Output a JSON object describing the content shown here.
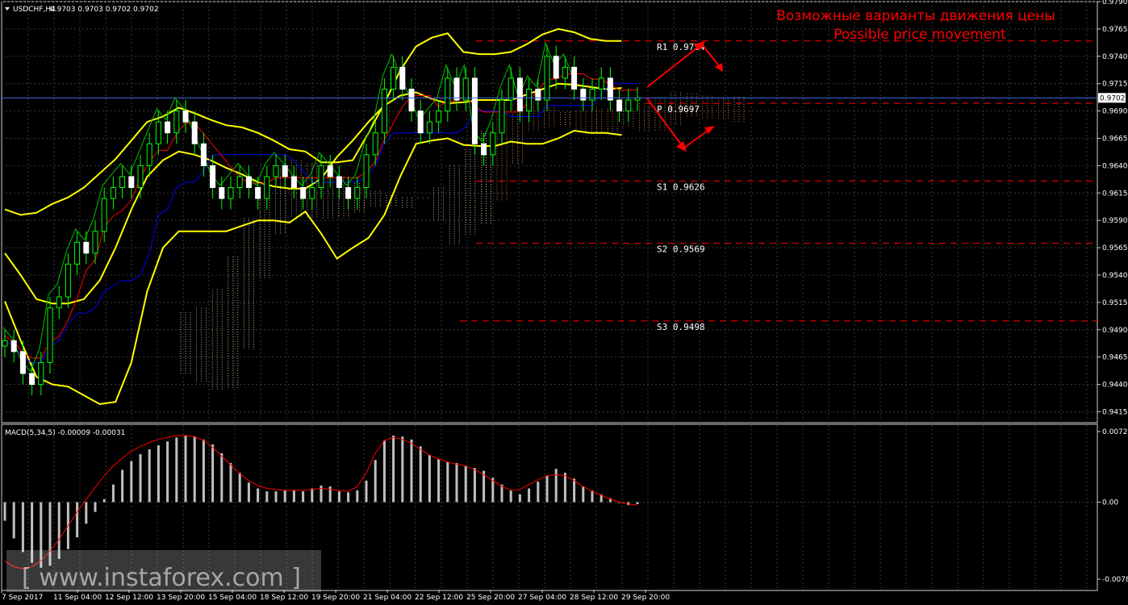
{
  "main_header": {
    "symbol": "USDCHF,H4",
    "ohlc": "0.9703 0.9703 0.9702 0.9702"
  },
  "annotation": {
    "ru": "Возможные варианты движения цены",
    "en": "Possible price movement"
  },
  "current_price_label": "0.9702",
  "watermark": "[ www.instaforex.com ]",
  "colors": {
    "background": "#000000",
    "grid": "#3a3a3a",
    "axis_text": "#ffffff",
    "candle_bull": "#00ff00",
    "bollinger": "#ffff00",
    "tenkan": "#ff0000",
    "kijun": "#0000ff",
    "chikou": "#00c000",
    "kumo_a": "#f4a460",
    "kumo_b": "#f5deb3",
    "pivot_level": "#ff0000",
    "annotation": "#ff0000",
    "macd_hist": "#c0c0c0",
    "macd_signal": "#ff0000",
    "current_price_line": "#4169e1"
  },
  "chart_data": [
    {
      "type": "candlestick",
      "title": "USDCHF,H4",
      "ylim": [
        0.9405,
        0.979
      ],
      "y_ticks": [
        "0.9790",
        "0.9765",
        "0.9740",
        "0.9715",
        "0.9690",
        "0.9665",
        "0.9640",
        "0.9615",
        "0.9590",
        "0.9565",
        "0.9540",
        "0.9515",
        "0.9490",
        "0.9465",
        "0.9440",
        "0.9415"
      ],
      "x_ticks": [
        "7 Sep 2017",
        "11 Sep 04:00",
        "12 Sep 12:00",
        "13 Sep 20:00",
        "15 Sep 04:00",
        "18 Sep 12:00",
        "19 Sep 20:00",
        "21 Sep 04:00",
        "22 Sep 12:00",
        "25 Sep 20:00",
        "27 Sep 04:00",
        "28 Sep 12:00",
        "29 Sep 20:00"
      ],
      "current_price": 0.9702,
      "levels": [
        {
          "name": "R1",
          "label": "R1 0.9754",
          "value": 0.9754
        },
        {
          "name": "P",
          "label": "P 0.9697",
          "value": 0.9697
        },
        {
          "name": "S1",
          "label": "S1 0.9626",
          "value": 0.9626
        },
        {
          "name": "S2",
          "label": "S2 0.9569",
          "value": 0.9569
        },
        {
          "name": "S3",
          "label": "S3 0.9498",
          "value": 0.9498
        }
      ],
      "close": [
        0.948,
        0.947,
        0.945,
        0.944,
        0.946,
        0.951,
        0.952,
        0.955,
        0.957,
        0.956,
        0.958,
        0.961,
        0.962,
        0.963,
        0.962,
        0.964,
        0.966,
        0.968,
        0.967,
        0.969,
        0.968,
        0.966,
        0.964,
        0.962,
        0.961,
        0.962,
        0.963,
        0.962,
        0.961,
        0.963,
        0.964,
        0.963,
        0.962,
        0.961,
        0.962,
        0.964,
        0.963,
        0.962,
        0.961,
        0.962,
        0.965,
        0.967,
        0.971,
        0.973,
        0.971,
        0.969,
        0.967,
        0.968,
        0.969,
        0.972,
        0.97,
        0.972,
        0.966,
        0.965,
        0.967,
        0.97,
        0.972,
        0.969,
        0.971,
        0.97,
        0.974,
        0.972,
        0.973,
        0.971,
        0.97,
        0.971,
        0.972,
        0.97,
        0.969,
        0.97,
        0.9702
      ],
      "bollinger": {
        "upper": [
          0.96,
          0.9595,
          0.9597,
          0.9605,
          0.9611,
          0.962,
          0.9633,
          0.9646,
          0.9663,
          0.968,
          0.9685,
          0.9693,
          0.9688,
          0.9682,
          0.9677,
          0.9675,
          0.967,
          0.9663,
          0.9655,
          0.9653,
          0.9643,
          0.9643,
          0.9645,
          0.967,
          0.9697,
          0.9727,
          0.9749,
          0.9757,
          0.9761,
          0.9744,
          0.9742,
          0.9742,
          0.9744,
          0.9751,
          0.976,
          0.9765,
          0.9762,
          0.9756,
          0.9754,
          0.9754
        ],
        "middle": [
          0.956,
          0.954,
          0.9518,
          0.9514,
          0.9514,
          0.9518,
          0.9535,
          0.9565,
          0.96,
          0.963,
          0.9645,
          0.9653,
          0.965,
          0.9645,
          0.9638,
          0.9632,
          0.9625,
          0.9621,
          0.9619,
          0.9619,
          0.9628,
          0.9648,
          0.9663,
          0.968,
          0.9695,
          0.9704,
          0.9707,
          0.9701,
          0.9697,
          0.9698,
          0.97,
          0.97,
          0.97,
          0.9705,
          0.971,
          0.9715,
          0.9714,
          0.9712,
          0.971,
          0.9711
        ],
        "lower": [
          0.9516,
          0.948,
          0.9447,
          0.944,
          0.9438,
          0.943,
          0.9422,
          0.9424,
          0.946,
          0.9525,
          0.9565,
          0.958,
          0.958,
          0.958,
          0.958,
          0.9585,
          0.959,
          0.959,
          0.9588,
          0.9598,
          0.9578,
          0.9555,
          0.9565,
          0.9574,
          0.9595,
          0.963,
          0.966,
          0.9663,
          0.9665,
          0.9659,
          0.9658,
          0.9658,
          0.9662,
          0.966,
          0.966,
          0.9665,
          0.9672,
          0.967,
          0.967,
          0.9668
        ]
      }
    },
    {
      "type": "bar",
      "title": "MACD(5,34,5) -0.00009 -0.00031",
      "ylim": [
        -0.00787,
        0.00721
      ],
      "y_ticks": [
        "0.00721",
        "0.00",
        "-0.00787"
      ],
      "histogram": [
        -0.0019,
        -0.0037,
        -0.0051,
        -0.0062,
        -0.0067,
        -0.0065,
        -0.0058,
        -0.0048,
        -0.0036,
        -0.0022,
        -0.001,
        0.0003,
        0.0018,
        0.0033,
        0.0042,
        0.0049,
        0.0054,
        0.0058,
        0.0062,
        0.0066,
        0.0068,
        0.0067,
        0.0064,
        0.0059,
        0.005,
        0.004,
        0.003,
        0.002,
        0.0014,
        0.0011,
        0.0011,
        0.0012,
        0.0012,
        0.0011,
        0.0014,
        0.0017,
        0.0016,
        0.0011,
        0.001,
        0.0012,
        0.0022,
        0.0043,
        0.0063,
        0.0068,
        0.0067,
        0.0064,
        0.0057,
        0.0048,
        0.0044,
        0.0041,
        0.004,
        0.0037,
        0.0035,
        0.0032,
        0.0025,
        0.0018,
        0.0012,
        0.0008,
        0.0014,
        0.0021,
        0.0027,
        0.0034,
        0.003,
        0.0024,
        0.0016,
        0.0012,
        0.0008,
        0.0004,
        0.0,
        -0.0003,
        -0.0002
      ],
      "signal": [
        -0.006,
        -0.0066,
        -0.0068,
        -0.0066,
        -0.006,
        -0.005,
        -0.0038,
        -0.0024,
        -0.001,
        0.0003,
        0.0015,
        0.0027,
        0.0037,
        0.0045,
        0.0052,
        0.0057,
        0.0061,
        0.0064,
        0.0066,
        0.0068,
        0.0068,
        0.0067,
        0.0063,
        0.0056,
        0.0047,
        0.0038,
        0.0029,
        0.0022,
        0.0017,
        0.0014,
        0.0013,
        0.0012,
        0.0012,
        0.0012,
        0.0013,
        0.0014,
        0.0013,
        0.0012,
        0.0011,
        0.0016,
        0.003,
        0.005,
        0.0063,
        0.0066,
        0.0064,
        0.006,
        0.0054,
        0.0048,
        0.0044,
        0.0041,
        0.0039,
        0.0037,
        0.0033,
        0.0028,
        0.0022,
        0.0016,
        0.0012,
        0.0013,
        0.0018,
        0.0023,
        0.0027,
        0.0028,
        0.0027,
        0.0022,
        0.0016,
        0.0011,
        0.0007,
        0.0003,
        0.0,
        -0.0002,
        -0.0003
      ]
    }
  ]
}
